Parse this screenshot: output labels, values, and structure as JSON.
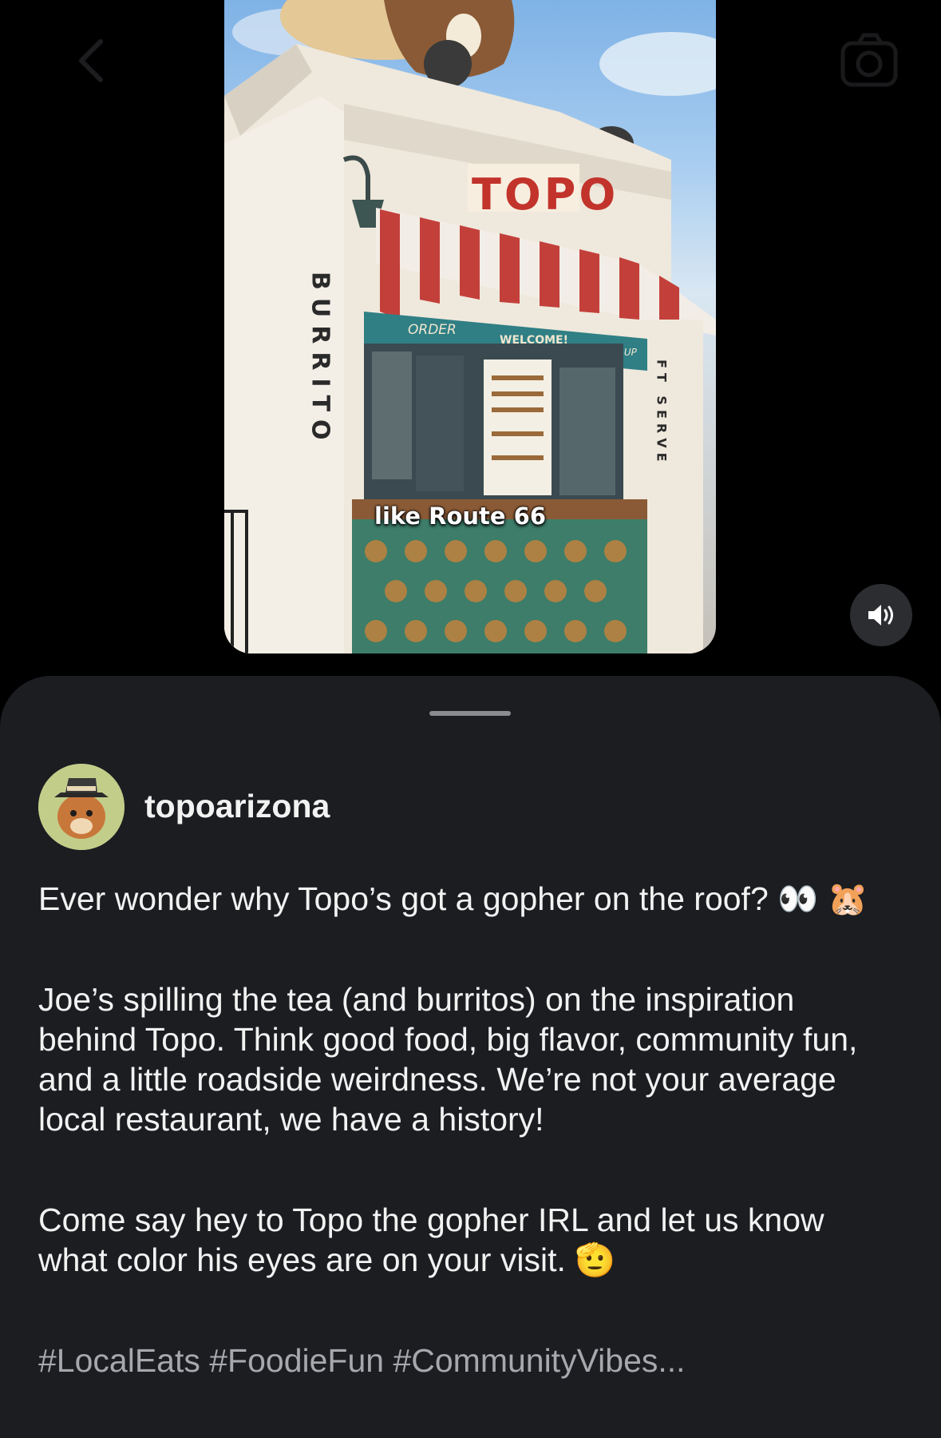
{
  "video": {
    "caption": "like Route 66",
    "sign_topo": "TOPO",
    "sign_burrito": "BURRITO",
    "sign_order": "ORDER",
    "sign_welcome": "WELCOME!",
    "sign_pickup": "PICK UP",
    "sign_soft_serve": "FT SERVE"
  },
  "controls": {
    "back_icon": "chevron-left-icon",
    "camera_icon": "camera-icon",
    "sound_icon": "speaker-on-icon"
  },
  "post": {
    "username": "topoarizona",
    "paragraph_1": "Ever wonder why Topo’s got a gopher on the roof? 👀 🐹",
    "paragraph_2": "Joe’s spilling the tea (and burritos) on the inspiration behind Topo. Think good food, big flavor, community fun, and a little roadside weirdness. We’re not your average local restaurant, we have a history!",
    "paragraph_3": "Come say hey to Topo the gopher IRL and let us know what color his eyes are on your visit. 🫡",
    "hashtags": "#LocalEats #FoodieFun #CommunityVibes..."
  }
}
